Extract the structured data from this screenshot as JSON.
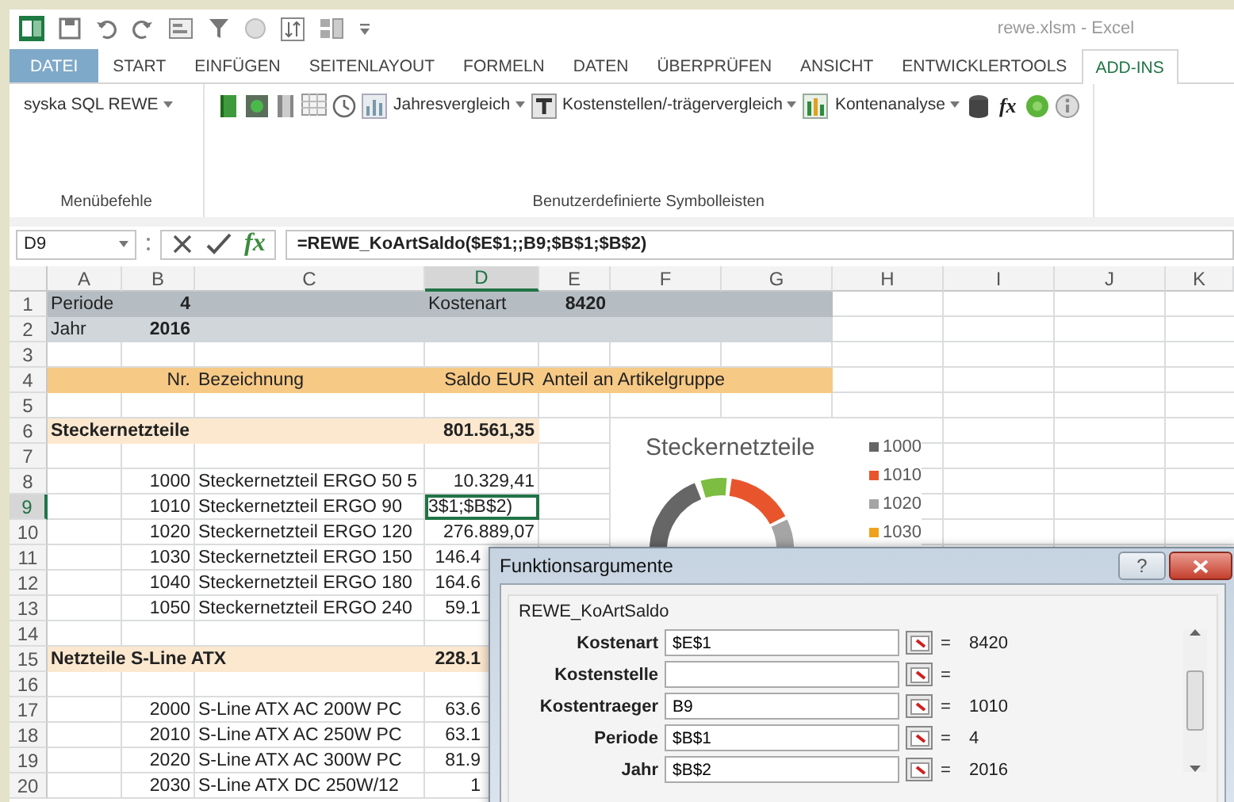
{
  "window": {
    "title": "rewe.xlsm - Excel"
  },
  "tabs": [
    {
      "label": "DATEI",
      "selected": false
    },
    {
      "label": "START",
      "selected": false
    },
    {
      "label": "EINFÜGEN",
      "selected": false
    },
    {
      "label": "SEITENLAYOUT",
      "selected": false
    },
    {
      "label": "FORMELN",
      "selected": false
    },
    {
      "label": "DATEN",
      "selected": false
    },
    {
      "label": "ÜBERPRÜFEN",
      "selected": false
    },
    {
      "label": "ANSICHT",
      "selected": false
    },
    {
      "label": "ENTWICKLERTOOLS",
      "selected": false
    },
    {
      "label": "ADD-INS",
      "selected": true
    }
  ],
  "ribbon": {
    "groups": [
      {
        "label": "Menübefehle",
        "items": [
          {
            "kind": "dropdown",
            "label": "syska SQL REWE"
          }
        ]
      },
      {
        "label": "Benutzerdefinierte Symbolleisten",
        "items": [
          {
            "kind": "icon"
          },
          {
            "kind": "icon"
          },
          {
            "kind": "icon"
          },
          {
            "kind": "icon"
          },
          {
            "kind": "icon"
          },
          {
            "kind": "icon"
          },
          {
            "kind": "dropdown",
            "label": "Jahresvergleich"
          },
          {
            "kind": "icon"
          },
          {
            "kind": "dropdown",
            "label": "Kostenstellen/-trägervergleich"
          },
          {
            "kind": "icon"
          },
          {
            "kind": "dropdown",
            "label": "Kontenanalyse"
          },
          {
            "kind": "icon"
          },
          {
            "kind": "text",
            "label": "fx"
          },
          {
            "kind": "icon"
          },
          {
            "kind": "icon"
          }
        ]
      }
    ]
  },
  "formula_bar": {
    "name_box": "D9",
    "fx": "fx",
    "formula": "=REWE_KoArtSaldo($E$1;;B9;$B$1;$B$2)"
  },
  "sheet": {
    "columns": [
      {
        "label": "A",
        "selected": false
      },
      {
        "label": "B",
        "selected": false
      },
      {
        "label": "C",
        "selected": false
      },
      {
        "label": "D",
        "selected": true
      },
      {
        "label": "E",
        "selected": false
      },
      {
        "label": "F",
        "selected": false
      },
      {
        "label": "G",
        "selected": false
      },
      {
        "label": "H",
        "selected": false
      },
      {
        "label": "I",
        "selected": false
      },
      {
        "label": "J",
        "selected": false
      },
      {
        "label": "K",
        "selected": false
      }
    ],
    "rows": [
      {
        "n": "1",
        "kind": "param1",
        "selected": false,
        "cells": [
          "Periode",
          "4",
          null,
          "Kostenart",
          "8420"
        ]
      },
      {
        "n": "2",
        "kind": "param2",
        "selected": false,
        "cells": [
          "Jahr",
          "2016"
        ]
      },
      {
        "n": "3",
        "kind": "blank",
        "selected": false
      },
      {
        "n": "4",
        "kind": "header",
        "selected": false,
        "cells": [
          null,
          "Nr.",
          "Bezeichnung",
          "Saldo EUR",
          "Anteil an Artikelgruppe"
        ]
      },
      {
        "n": "5",
        "kind": "blank",
        "selected": false
      },
      {
        "n": "6",
        "kind": "group",
        "selected": false,
        "cells": [
          "Steckernetzteile",
          null,
          null,
          "801.561,35"
        ]
      },
      {
        "n": "7",
        "kind": "blank",
        "selected": false
      },
      {
        "n": "8",
        "kind": "item",
        "selected": false,
        "cells": [
          null,
          "1000",
          "Steckernetzteil ERGO 50 5",
          "10.329,41"
        ]
      },
      {
        "n": "9",
        "kind": "item",
        "selected": true,
        "cells": [
          null,
          "1010",
          "Steckernetzteil ERGO 90",
          "3$1;$B$2)"
        ]
      },
      {
        "n": "10",
        "kind": "item",
        "selected": false,
        "cells": [
          null,
          "1020",
          "Steckernetzteil ERGO 120",
          "276.889,07"
        ]
      },
      {
        "n": "11",
        "kind": "item",
        "selected": false,
        "cells": [
          null,
          "1030",
          "Steckernetzteil ERGO 150",
          "146.4"
        ]
      },
      {
        "n": "12",
        "kind": "item",
        "selected": false,
        "cells": [
          null,
          "1040",
          "Steckernetzteil ERGO 180",
          "164.6"
        ]
      },
      {
        "n": "13",
        "kind": "item",
        "selected": false,
        "cells": [
          null,
          "1050",
          "Steckernetzteil ERGO 240",
          "59.1"
        ]
      },
      {
        "n": "14",
        "kind": "blank",
        "selected": false
      },
      {
        "n": "15",
        "kind": "group",
        "selected": false,
        "cells": [
          "Netzteile S-Line ATX",
          null,
          null,
          "228.1"
        ]
      },
      {
        "n": "16",
        "kind": "blank",
        "selected": false
      },
      {
        "n": "17",
        "kind": "item",
        "selected": false,
        "cells": [
          null,
          "2000",
          "S-Line ATX AC 200W PC",
          "63.6"
        ]
      },
      {
        "n": "18",
        "kind": "item",
        "selected": false,
        "cells": [
          null,
          "2010",
          "S-Line ATX AC 250W PC",
          "63.1"
        ]
      },
      {
        "n": "19",
        "kind": "item",
        "selected": false,
        "cells": [
          null,
          "2020",
          "S-Line ATX AC 300W PC",
          "81.9"
        ]
      },
      {
        "n": "20",
        "kind": "item",
        "selected": false,
        "cells": [
          null,
          "2030",
          "S-Line ATX DC 250W/12",
          "1"
        ]
      }
    ]
  },
  "chart": {
    "title": "Steckernetzteile",
    "legend": [
      {
        "label": "1000",
        "color": "#666666"
      },
      {
        "label": "1010",
        "color": "#e8552d"
      },
      {
        "label": "1020",
        "color": "#a5a5a5"
      },
      {
        "label": "1030",
        "color": "#f0a21e"
      }
    ]
  },
  "dialog": {
    "title": "Funktionsargumente",
    "help": "?",
    "function": "REWE_KoArtSaldo",
    "args": [
      {
        "label": "Kostenart",
        "value": "$E$1",
        "sign": "=",
        "result": "8420"
      },
      {
        "label": "Kostenstelle",
        "sign": "="
      },
      {
        "label": "Kostentraeger",
        "value": "B9",
        "sign": "=",
        "result": "1010"
      },
      {
        "label": "Periode",
        "value": "$B$1",
        "sign": "=",
        "result": "4"
      },
      {
        "label": "Jahr",
        "value": "$B$2",
        "sign": "=",
        "result": "2016"
      }
    ]
  }
}
